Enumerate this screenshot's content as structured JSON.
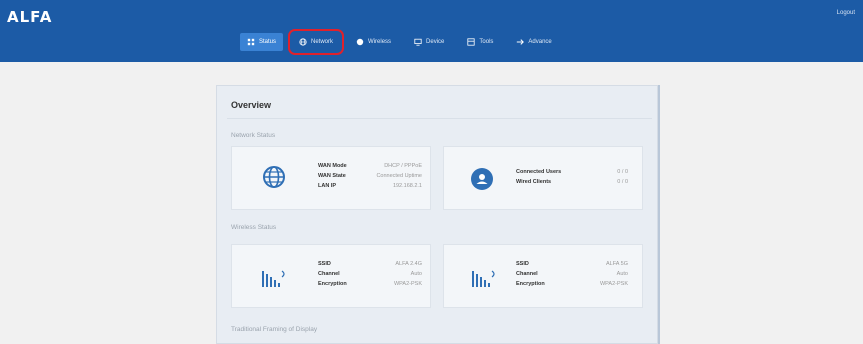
{
  "brand": {
    "logo": "ALFA",
    "logout": "Logout"
  },
  "nav": [
    {
      "label": "Status",
      "icon": "grid-icon"
    },
    {
      "label": "Network",
      "icon": "globe-icon"
    },
    {
      "label": "Wireless",
      "icon": "wifi-icon"
    },
    {
      "label": "Device",
      "icon": "monitor-icon"
    },
    {
      "label": "Tools",
      "icon": "toolbox-icon"
    },
    {
      "label": "Advance",
      "icon": "advance-icon"
    }
  ],
  "overview": {
    "title": "Overview",
    "network_status": {
      "label": "Network Status",
      "internet": {
        "icon": "globe-icon",
        "rows": [
          {
            "k": "WAN Mode",
            "v": "DHCP / PPPoE"
          },
          {
            "k": "WAN State",
            "v": "Connected Uptime"
          },
          {
            "k": "LAN IP",
            "v": "192.168.2.1"
          }
        ]
      },
      "clients": {
        "icon": "clients-icon",
        "rows": [
          {
            "k": "Connected Users",
            "v": "0 / 0"
          },
          {
            "k": "Wired Clients",
            "v": "0 / 0"
          }
        ]
      }
    },
    "wireless_status": {
      "label": "Wireless Status",
      "radio_2g": {
        "icon": "signal-icon",
        "rows": [
          {
            "k": "SSID",
            "v": "ALFA 2.4G"
          },
          {
            "k": "Channel",
            "v": "Auto"
          },
          {
            "k": "Encryption",
            "v": "WPA2-PSK"
          }
        ]
      },
      "radio_5g": {
        "icon": "signal-icon",
        "rows": [
          {
            "k": "SSID",
            "v": "ALFA 5G"
          },
          {
            "k": "Channel",
            "v": "Auto"
          },
          {
            "k": "Encryption",
            "v": "WPA2-PSK"
          }
        ]
      }
    },
    "third_section": {
      "label": "Traditional Framing of Display"
    }
  },
  "colors": {
    "header": "#1c5ba6",
    "active_tab": "#3a82d4",
    "highlight": "#e0212c",
    "card_icon": "#2f6fb5"
  }
}
